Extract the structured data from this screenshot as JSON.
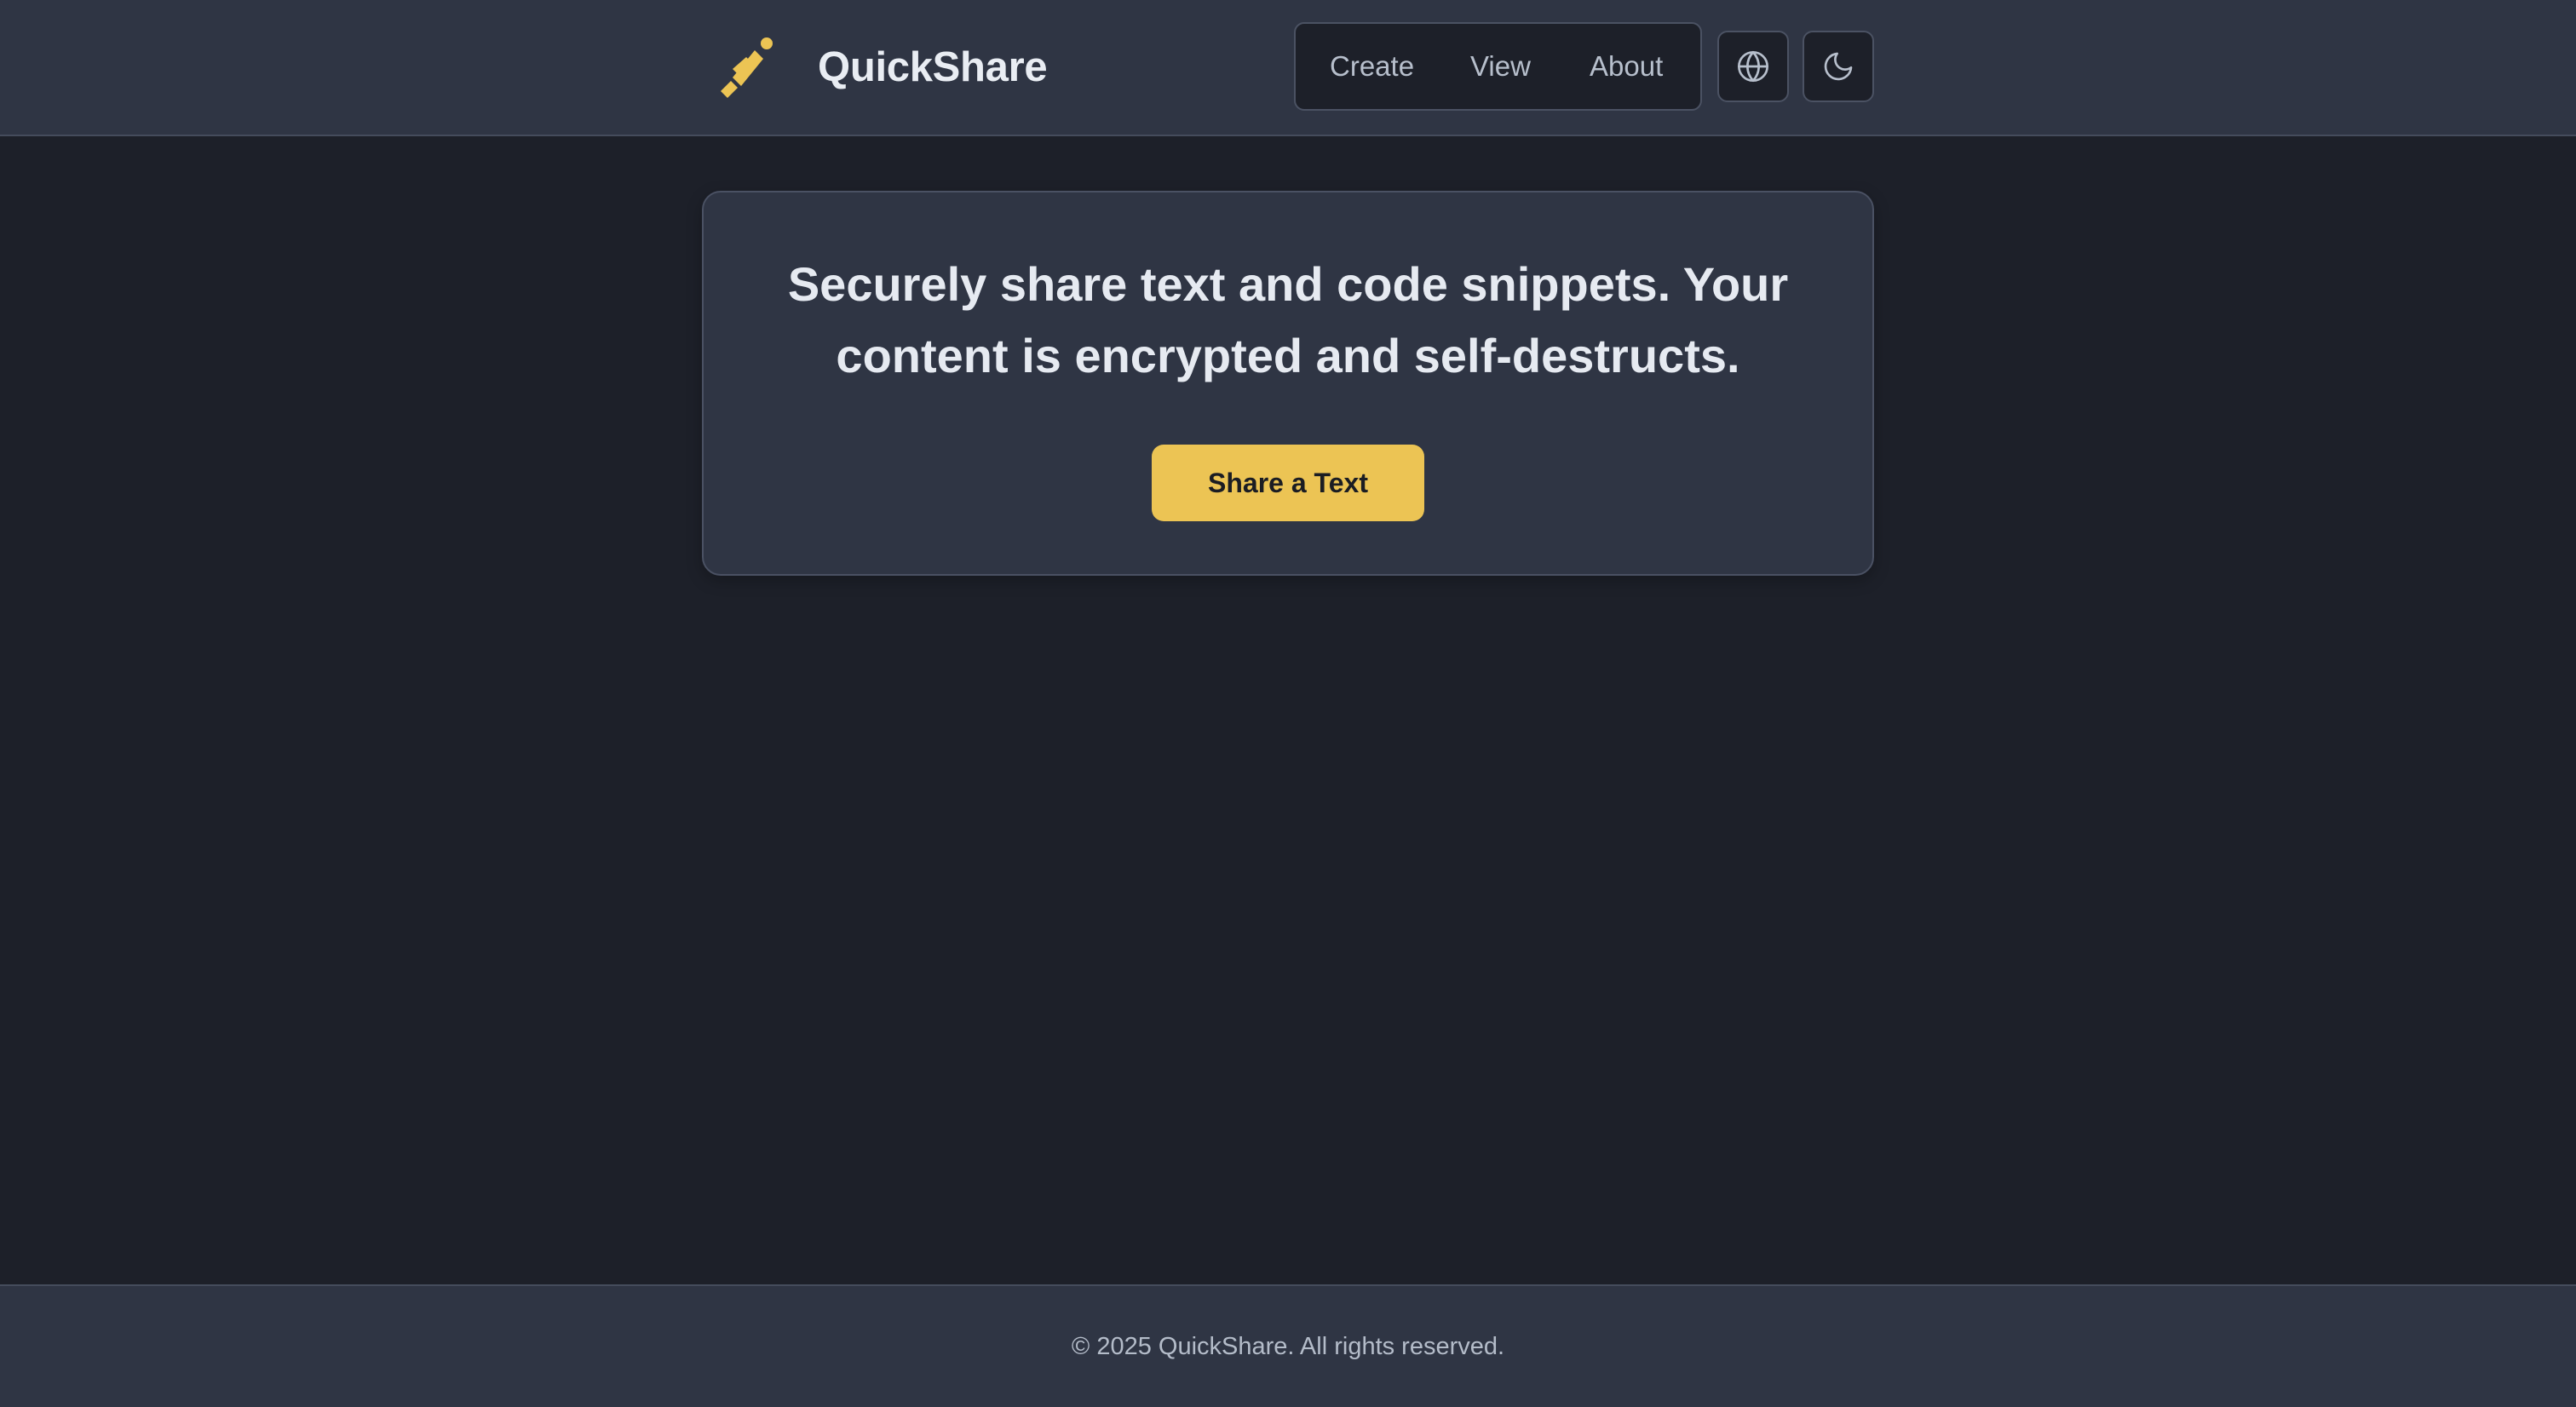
{
  "app": {
    "name": "QuickShare",
    "accent_color": "#ecc454"
  },
  "nav": {
    "items": [
      {
        "label": "Create"
      },
      {
        "label": "View"
      },
      {
        "label": "About"
      }
    ]
  },
  "toolbar": {
    "language_icon": "globe-icon",
    "theme_icon": "moon-icon"
  },
  "hero": {
    "title": "Securely share text and code snippets. Your content is encrypted and self-destructs.",
    "button_label": "Share a Text"
  },
  "footer": {
    "copyright": "© 2025 QuickShare. All rights reserved."
  }
}
